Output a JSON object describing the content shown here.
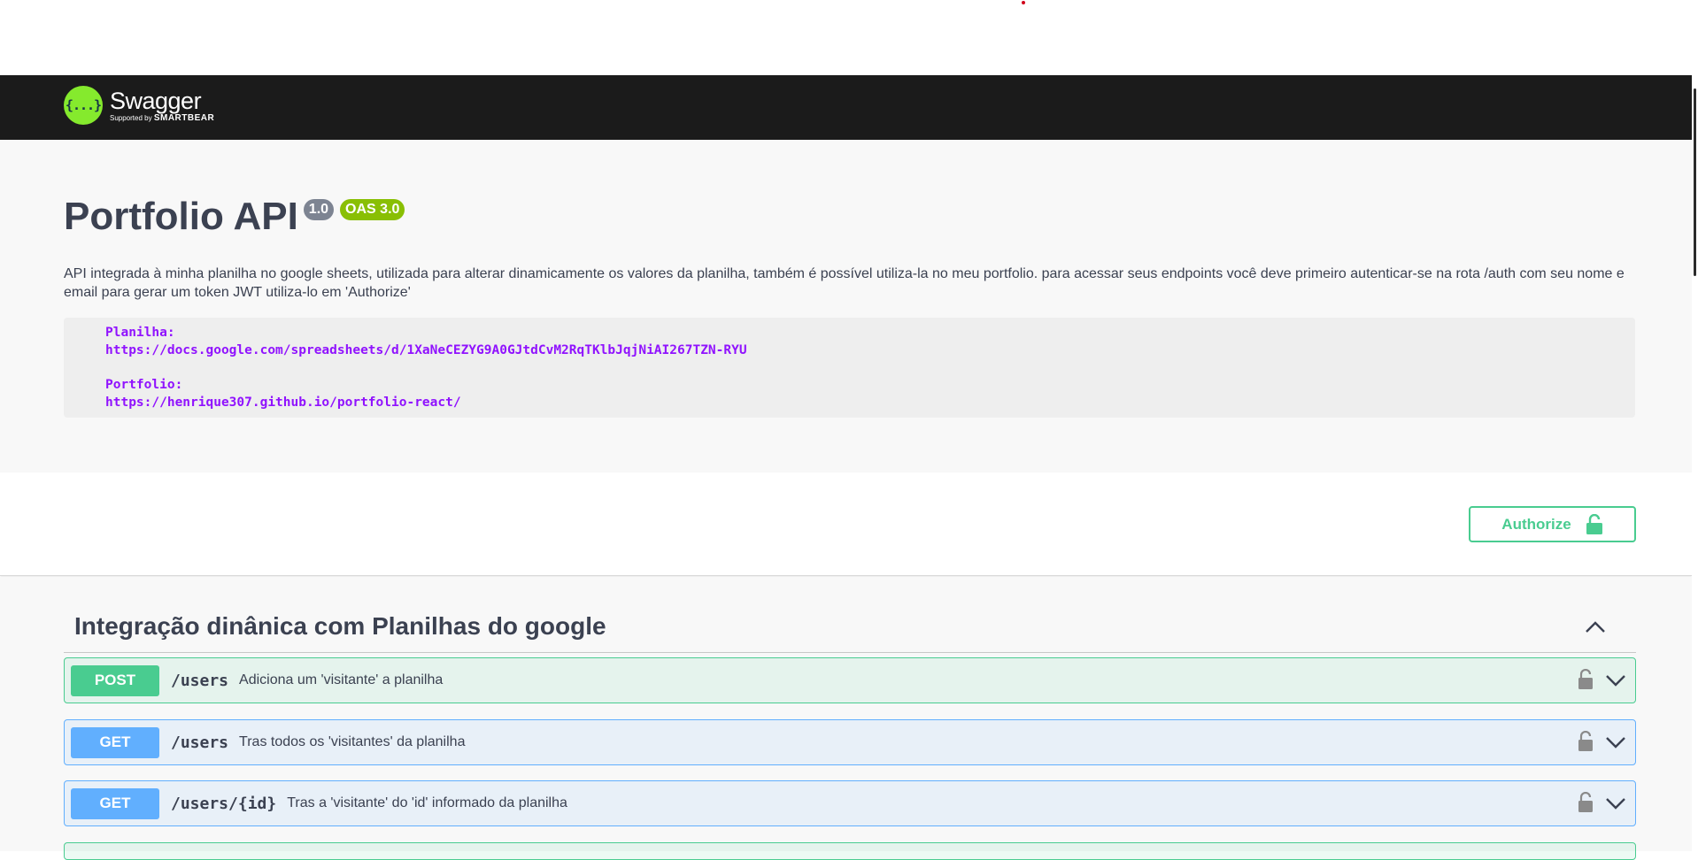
{
  "topbar": {
    "logo_mark": "{...}",
    "logo_name": "Swagger",
    "logo_sub_prefix": "Supported by",
    "logo_sub_brand": "SMARTBEAR"
  },
  "info": {
    "title": "Portfolio API",
    "version": "1.0",
    "oas": "OAS 3.0",
    "description": "API integrada à minha planilha no google sheets, utilizada para alterar dinamicamente os valores da planilha, também é possível utiliza-la no meu portfolio. para acessar seus endpoints você deve primeiro autenticar-se na rota /auth com seu nome e email para gerar um token JWT utiliza-lo em 'Authorize'",
    "code": {
      "planilha_label": "Planilha:",
      "planilha_url": "https://docs.google.com/spreadsheets/d/1XaNeCEZYG9A0GJtdCvM2RqTKlbJqjNiAI267TZN-RYU",
      "portfolio_label": "Portfolio:",
      "portfolio_url": "https://henrique307.github.io/portfolio-react/"
    }
  },
  "authorize": {
    "label": "Authorize",
    "icon": "lock-open-icon"
  },
  "tag": {
    "title": "Integração dinânica com Planilhas do google",
    "toggle_icon": "chevron-up-icon"
  },
  "operations": [
    {
      "method": "POST",
      "path": "/users",
      "summary": "Adiciona um 'visitante' a planilha"
    },
    {
      "method": "GET",
      "path": "/users",
      "summary": "Tras todos os 'visitantes' da planilha"
    },
    {
      "method": "GET",
      "path": "/users/{id}",
      "summary": "Tras a 'visitante' do 'id' informado da planilha"
    }
  ],
  "colors": {
    "post": "#49cc90",
    "get": "#61affe",
    "topbar": "#1b1b1b",
    "logo": "#85ea2d",
    "code_text": "#9012fe"
  }
}
